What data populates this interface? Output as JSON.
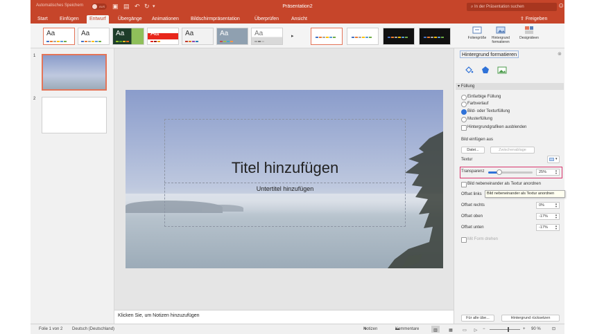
{
  "titlebar": {
    "autosave_label": "Automatisches Speichern",
    "autosave_toggle": "AUS",
    "document_title": "Präsentation2",
    "search_placeholder": "In der Präsentation suchen"
  },
  "tabs": [
    "Start",
    "Einfügen",
    "Entwurf",
    "Übergänge",
    "Animationen",
    "Bildschirmpräsentation",
    "Überprüfen",
    "Ansicht"
  ],
  "active_tab": "Entwurf",
  "share_label": "Freigeben",
  "ribbon": {
    "themes": [
      "Aa",
      "Aa",
      "Aa",
      "Aa",
      "Aa",
      "Aa",
      "Aa"
    ],
    "buttons": {
      "slide_size": "Foliengröße",
      "format_background": "Hintergrund formatieren",
      "design_ideas": "Designideen"
    }
  },
  "slides": [
    "1",
    "2"
  ],
  "slide": {
    "title": "Titel hinzufügen",
    "subtitle": "Untertitel hinzufügen"
  },
  "notes_placeholder": "Klicken Sie, um Notizen hinzuzufügen",
  "pane": {
    "title": "Hintergrund formatieren",
    "section": "Füllung",
    "fill_options": [
      "Einfarbige Füllung",
      "Farbverlauf",
      "Bild- oder Texturfüllung",
      "Musterfüllung"
    ],
    "selected_fill": "Bild- oder Texturfüllung",
    "hide_graphics": "Hintergrundgrafiken ausblenden",
    "insert_image_from": "Bild einfügen aus",
    "file_button": "Datei...",
    "clipboard_button": "Zwischenablage",
    "texture_label": "Textur",
    "transparency_label": "Transparenz",
    "transparency_value": "25%",
    "transparency_fraction": 0.25,
    "tile_label": "Bild nebeneinander als Textur anordnen",
    "tooltip": "Bild nebeneinander als Textur anordnen",
    "offset_left_label": "Offset links",
    "offset_right_label": "Offset rechts",
    "offset_right_value": "0%",
    "offset_top_label": "Offset oben",
    "offset_top_value": "-17%",
    "offset_bottom_label": "Offset unten",
    "offset_bottom_value": "-17%",
    "rotate_with_shape": "Mit Form drehen",
    "apply_all_button": "Für alle übe...",
    "reset_button": "Hintergrund rücksetzen"
  },
  "status": {
    "slide_info": "Folie 1 von 2",
    "language": "Deutsch (Deutschland)",
    "notes": "Notizen",
    "comments": "Kommentare",
    "zoom": "90 %",
    "zoom_fraction": 0.6
  },
  "colors": {
    "accent": "#c6452a",
    "highlight": "#d8336b",
    "selection": "#e47458"
  }
}
